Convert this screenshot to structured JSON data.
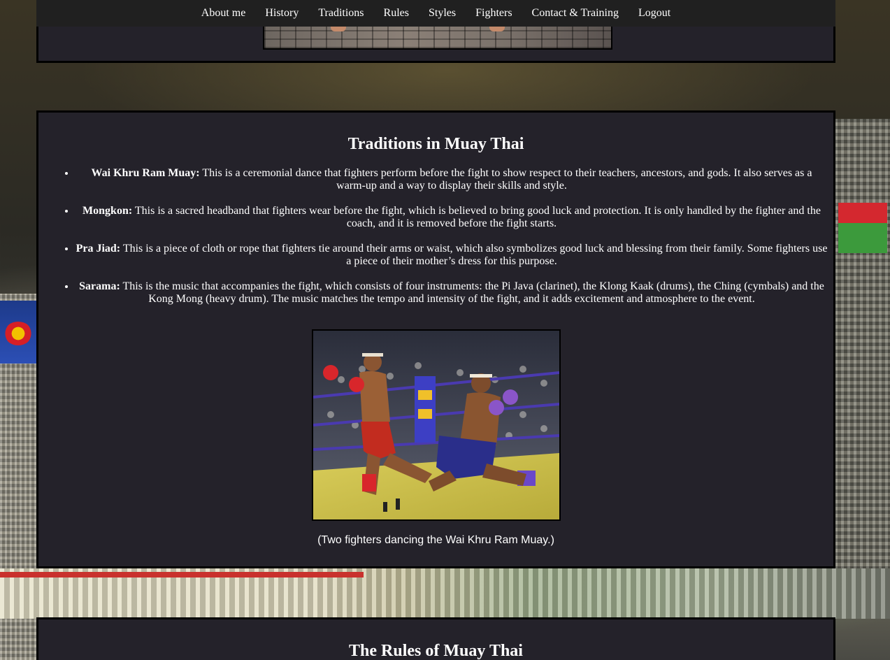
{
  "nav": {
    "items": [
      {
        "label": "About me"
      },
      {
        "label": "History"
      },
      {
        "label": "Traditions"
      },
      {
        "label": "Rules"
      },
      {
        "label": "Styles"
      },
      {
        "label": "Fighters"
      },
      {
        "label": "Contact & Training"
      },
      {
        "label": "Logout"
      }
    ]
  },
  "traditions": {
    "title": "Traditions in Muay Thai",
    "items": [
      {
        "term": "Wai Khru Ram Muay:",
        "text": " This is a ceremonial dance that fighters perform before the fight to show respect to their teachers, ancestors, and gods. It also serves as a warm-up and a way to display their skills and style."
      },
      {
        "term": "Mongkon:",
        "text": " This is a sacred headband that fighters wear before the fight, which is believed to bring good luck and protection. It is only handled by the fighter and the coach, and it is removed before the fight starts."
      },
      {
        "term": "Pra Jiad:",
        "text": " This is a piece of cloth or rope that fighters tie around their arms or waist, which also symbolizes good luck and blessing from their family. Some fighters use a piece of their mother’s dress for this purpose."
      },
      {
        "term": "Sarama:",
        "text": " This is the music that accompanies the fight, which consists of four instruments: the Pi Java (clarinet), the Klong Kaak (drums), the Ching (cymbals) and the Kong Mong (heavy drum). The music matches the tempo and intensity of the fight, and it adds excitement and atmosphere to the event."
      }
    ],
    "caption": "(Two fighters dancing the Wai Khru Ram Muay.)"
  },
  "rules": {
    "title": "The Rules of Muay Thai"
  }
}
